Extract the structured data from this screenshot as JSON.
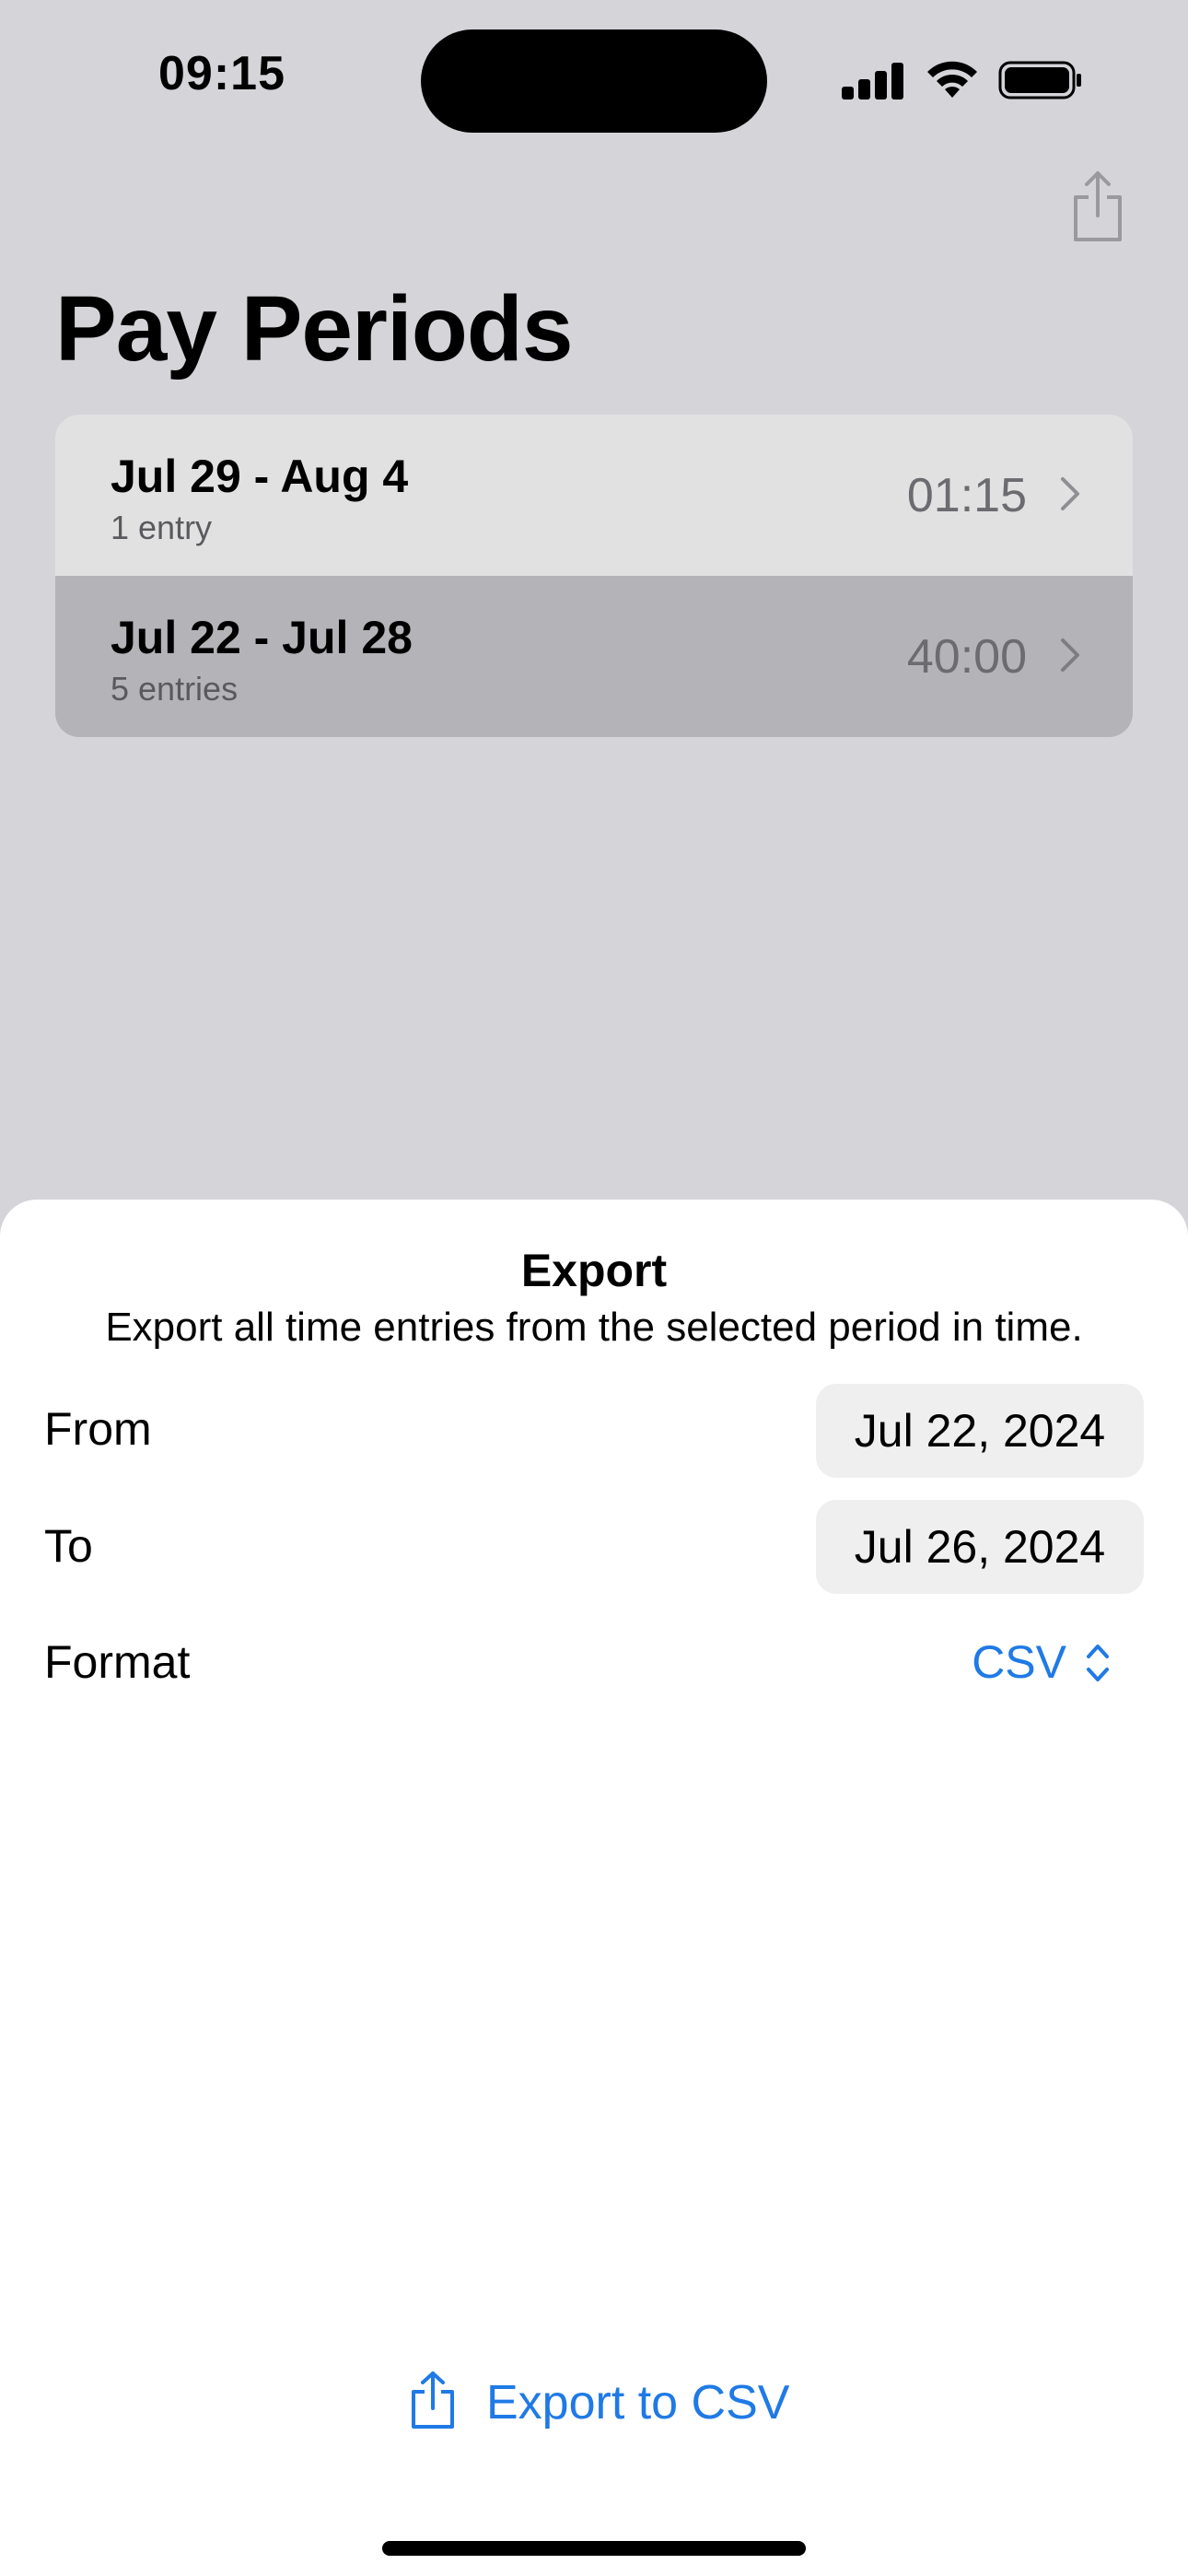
{
  "status_bar": {
    "time": "09:15",
    "icons": [
      "signal-icon",
      "wifi-icon",
      "battery-icon"
    ]
  },
  "header": {
    "share_icon": "share-icon",
    "title": "Pay Periods"
  },
  "periods": [
    {
      "range": "Jul 29 - Aug 4",
      "count": "1 entry",
      "total": "01:15",
      "selected": false
    },
    {
      "range": "Jul 22 - Jul 28",
      "count": "5 entries",
      "total": "40:00",
      "selected": true
    }
  ],
  "export_sheet": {
    "title": "Export",
    "subtitle": "Export all time entries from the selected period in time.",
    "from_label": "From",
    "from_value": "Jul 22, 2024",
    "to_label": "To",
    "to_value": "Jul 26, 2024",
    "format_label": "Format",
    "format_value": "CSV",
    "export_button_label": "Export to CSV"
  },
  "colors": {
    "accent": "#1f7ae6",
    "dimmed_background": "#d5d4d9",
    "selected_row": "#b4b3b8",
    "row": "#e1e1e2"
  }
}
